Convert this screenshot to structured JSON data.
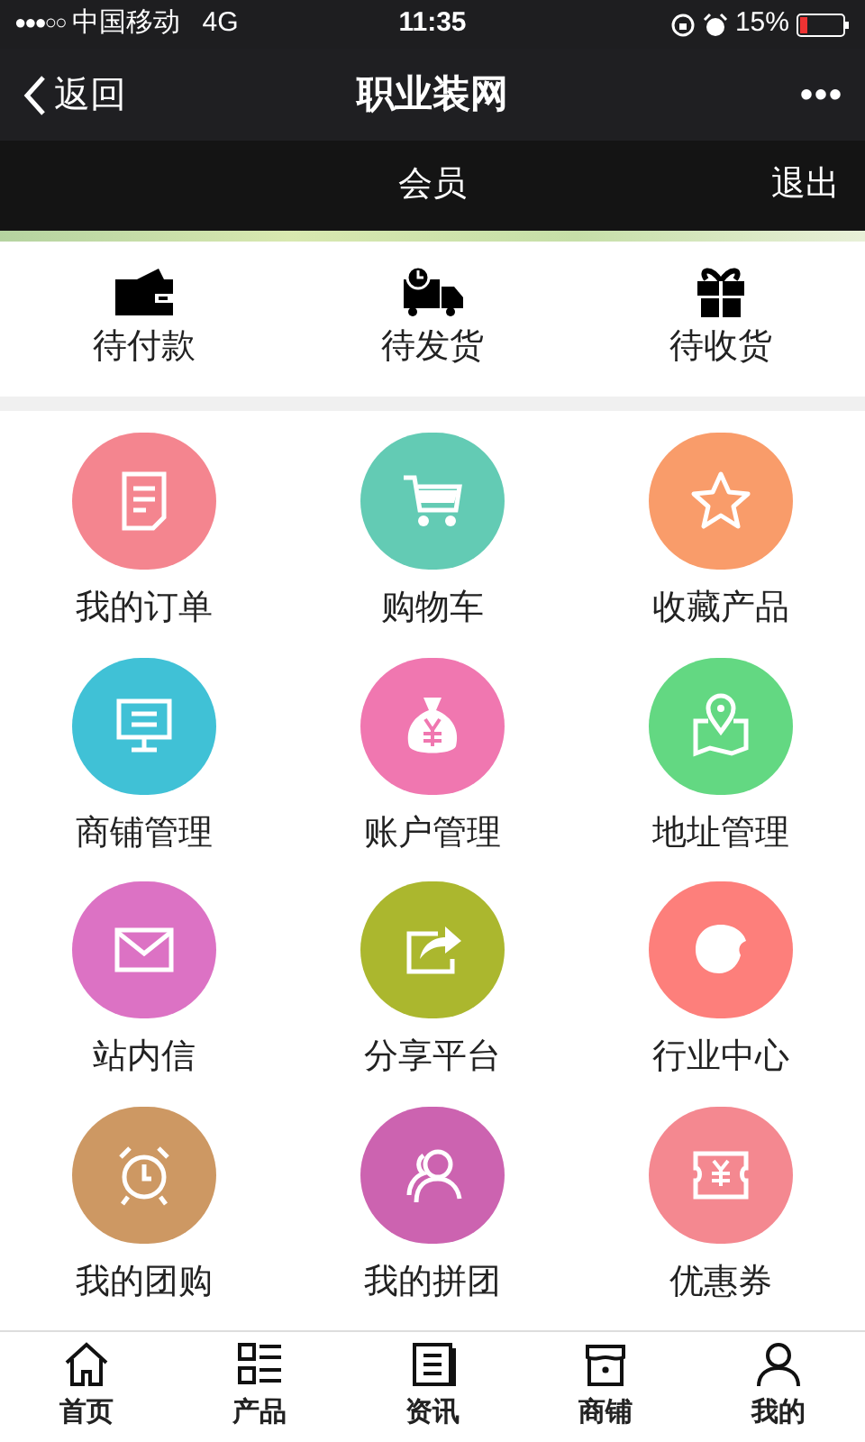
{
  "status_bar": {
    "signal": "●●●○○",
    "carrier": "中国移动",
    "network": "4G",
    "time": "11:35",
    "battery": "15%"
  },
  "nav_bar": {
    "back": "返回",
    "title": "职业装网",
    "more": "•••"
  },
  "header": {
    "title": "会员",
    "logout": "退出"
  },
  "orders": [
    {
      "kind": "wallet",
      "label": "待付款"
    },
    {
      "kind": "truck",
      "label": "待发货"
    },
    {
      "kind": "gift",
      "label": "待收货"
    }
  ],
  "menu": [
    {
      "kind": "document",
      "label": "我的订单",
      "color": "#f4858f"
    },
    {
      "kind": "cart",
      "label": "购物车",
      "color": "#63cbb4"
    },
    {
      "kind": "star",
      "label": "收藏产品",
      "color": "#f99c6a"
    },
    {
      "kind": "monitor",
      "label": "商铺管理",
      "color": "#40c1d6"
    },
    {
      "kind": "moneybag",
      "label": "账户管理",
      "color": "#f077b0"
    },
    {
      "kind": "map",
      "label": "地址管理",
      "color": "#63d882"
    },
    {
      "kind": "envelope",
      "label": "站内信",
      "color": "#dc72c4"
    },
    {
      "kind": "share",
      "label": "分享平台",
      "color": "#abb72e"
    },
    {
      "kind": "blob",
      "label": "行业中心",
      "color": "#fd7f7b"
    },
    {
      "kind": "alarm",
      "label": "我的团购",
      "color": "#cd9863"
    },
    {
      "kind": "people",
      "label": "我的拼团",
      "color": "#cc63b0"
    },
    {
      "kind": "ticket",
      "label": "优惠券",
      "color": "#f48890"
    }
  ],
  "tab_bar": [
    {
      "kind": "home",
      "label": "首页"
    },
    {
      "kind": "list",
      "label": "产品"
    },
    {
      "kind": "news",
      "label": "资讯"
    },
    {
      "kind": "shop",
      "label": "商铺"
    },
    {
      "kind": "user",
      "label": "我的"
    }
  ]
}
